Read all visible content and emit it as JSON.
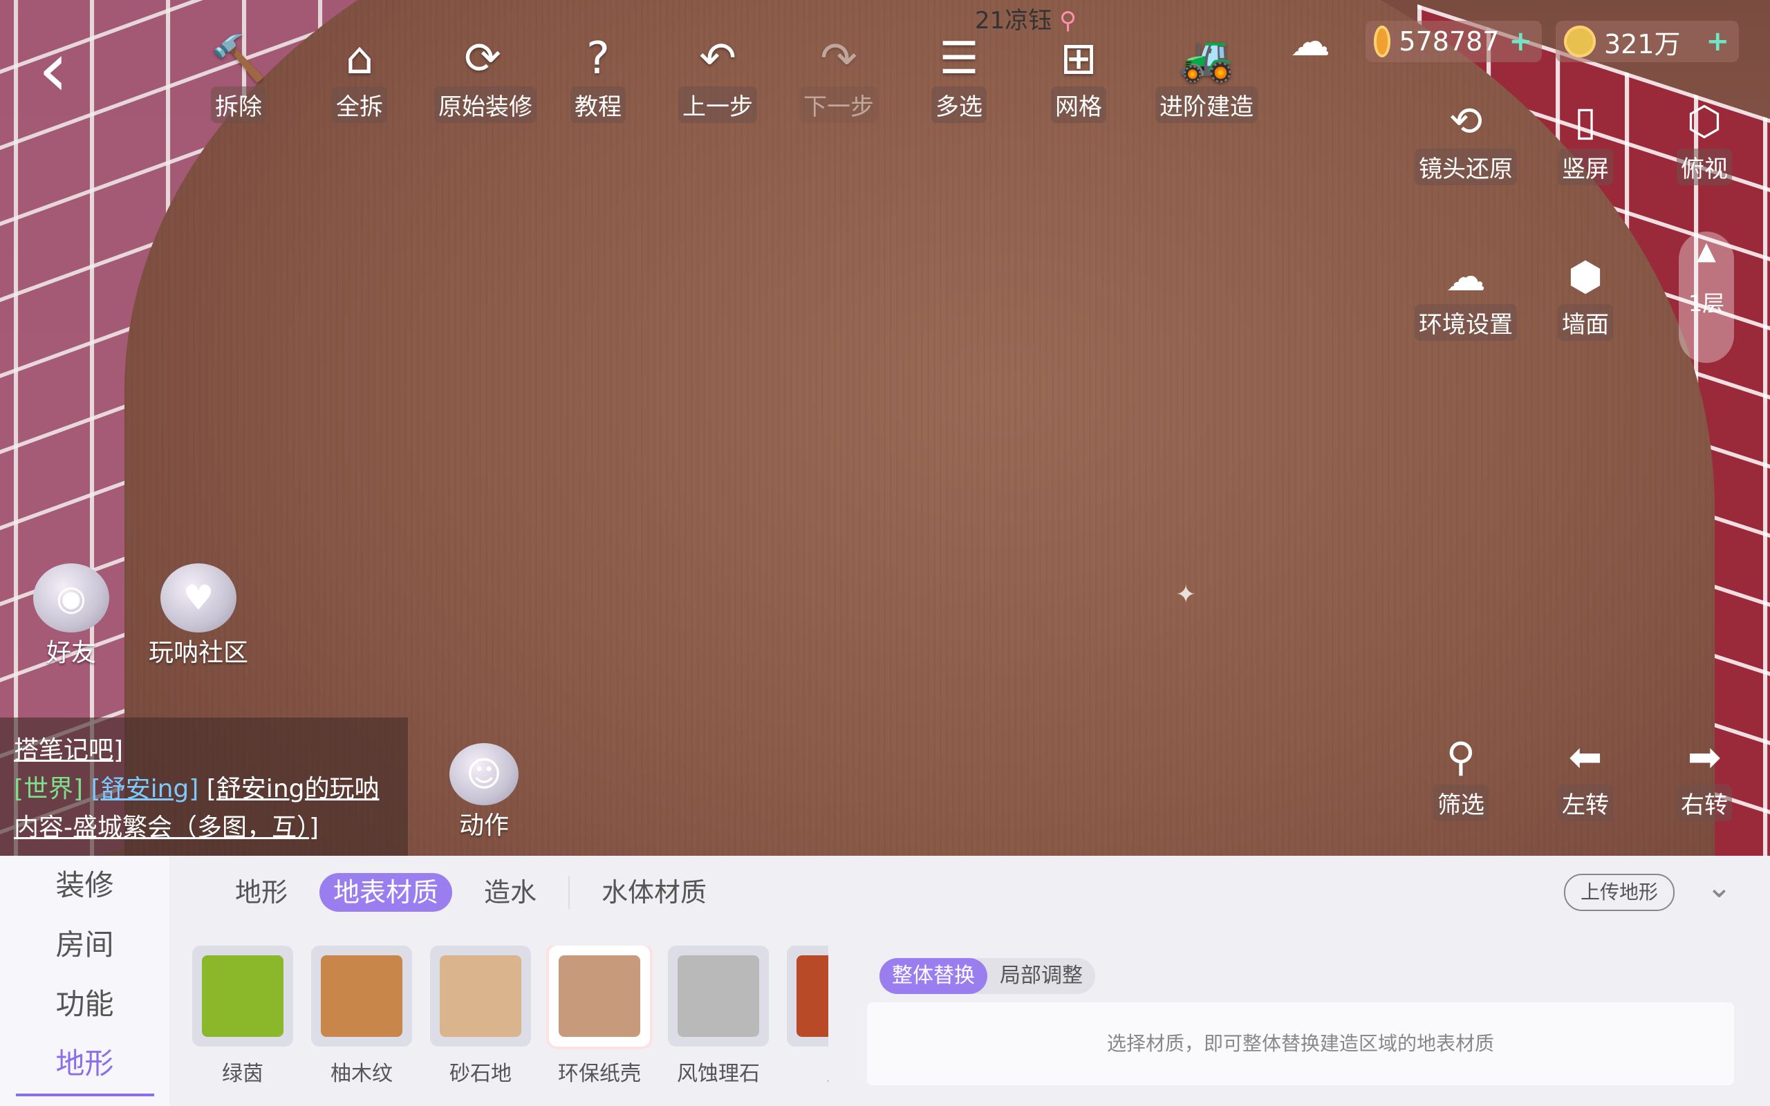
{
  "top_badge": {
    "text": "21凉钰"
  },
  "toolbar": [
    {
      "name": "demolish",
      "label": "拆除",
      "icon": "hammer-icon",
      "glyph": "🔨"
    },
    {
      "name": "demolish-all",
      "label": "全拆",
      "icon": "house-demolish-icon",
      "glyph": "⌂"
    },
    {
      "name": "original-decor",
      "label": "原始装修",
      "icon": "house-refresh-icon",
      "glyph": "⟳"
    },
    {
      "name": "tutorial",
      "label": "教程",
      "icon": "book-question-icon",
      "glyph": "?"
    },
    {
      "name": "undo",
      "label": "上一步",
      "icon": "undo-icon",
      "glyph": "↶"
    },
    {
      "name": "redo",
      "label": "下一步",
      "icon": "redo-icon",
      "glyph": "↷"
    },
    {
      "name": "multi-select",
      "label": "多选",
      "icon": "checklist-icon",
      "glyph": "☰"
    },
    {
      "name": "grid",
      "label": "网格",
      "icon": "grid-icon",
      "glyph": "⊞"
    },
    {
      "name": "advanced-build",
      "label": "进阶建造",
      "icon": "bulldozer-icon",
      "glyph": "🚜"
    }
  ],
  "resources": {
    "acorn": "578787",
    "gold": "321万"
  },
  "right_controls": {
    "camera_reset": "镜头还原",
    "portrait": "竖屏",
    "top_view": "俯视",
    "environment": "环境设置",
    "wall": "墙面",
    "floor": "1层"
  },
  "social": {
    "friends": "好友",
    "community": "玩呐社区",
    "action": "动作"
  },
  "chat": {
    "line1": "搭笔记吧]",
    "channel": "[世界]",
    "user": "[舒安ing]",
    "msg1": "[舒安ing的玩呐",
    "msg2": "内容-盛城繁会（多图，互）]"
  },
  "bottom_controls": {
    "filter": "筛选",
    "rotate_left": "左转",
    "rotate_right": "右转"
  },
  "panel": {
    "side_nav": [
      "装修",
      "房间",
      "功能",
      "地形"
    ],
    "tabs": [
      "地形",
      "地表材质",
      "造水",
      "水体材质"
    ],
    "upload": "上传地形",
    "modes": [
      "整体替换",
      "局部调整"
    ],
    "hint": "选择材质，即可整体替换建造区域的地表材质",
    "materials": [
      {
        "label": "绿茵",
        "color": "#8ab82a"
      },
      {
        "label": "柚木纹",
        "color": "#c8864a"
      },
      {
        "label": "砂石地",
        "color": "#d9b48c"
      },
      {
        "label": "环保纸壳",
        "color": "#c89a7c"
      },
      {
        "label": "风蚀理石",
        "color": "#b9b9b9"
      },
      {
        "label": "厚",
        "color": "#b84a28"
      }
    ]
  },
  "colors": {
    "accent": "#9a7ef0",
    "plus": "#6ee6c8"
  }
}
